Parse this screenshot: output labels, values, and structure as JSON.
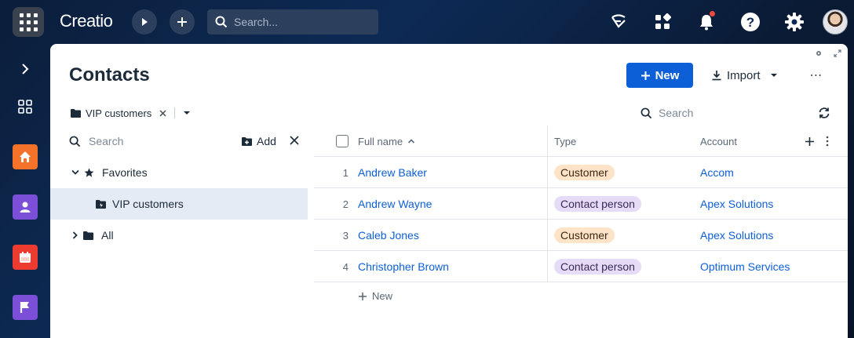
{
  "app": {
    "logo_text": "Creatio",
    "search_placeholder": "Search..."
  },
  "colors": {
    "primary": "#0d5fd8",
    "home": "#f5722b",
    "contacts": "#7b4fd8",
    "calendar": "#ee3b2f",
    "flag": "#7b4fd8"
  },
  "page": {
    "title": "Contacts",
    "new_label": "New",
    "import_label": "Import",
    "more_label": "⋯"
  },
  "filter": {
    "folder_chip": "VIP customers",
    "search_placeholder": "Search"
  },
  "folders": {
    "search_placeholder": "Search",
    "add_label": "Add",
    "items": [
      {
        "label": "Favorites"
      },
      {
        "label": "VIP customers"
      },
      {
        "label": "All"
      }
    ]
  },
  "grid": {
    "columns": [
      "Full name",
      "Type",
      "Account"
    ],
    "rows": [
      {
        "num": "1",
        "name": "Andrew Baker",
        "type": "Customer",
        "account": "Accom"
      },
      {
        "num": "2",
        "name": "Andrew Wayne",
        "type": "Contact person",
        "account": "Apex Solutions"
      },
      {
        "num": "3",
        "name": "Caleb Jones",
        "type": "Customer",
        "account": "Apex Solutions"
      },
      {
        "num": "4",
        "name": "Christopher Brown",
        "type": "Contact person",
        "account": "Optimum Services"
      }
    ],
    "add_row_label": "New"
  }
}
